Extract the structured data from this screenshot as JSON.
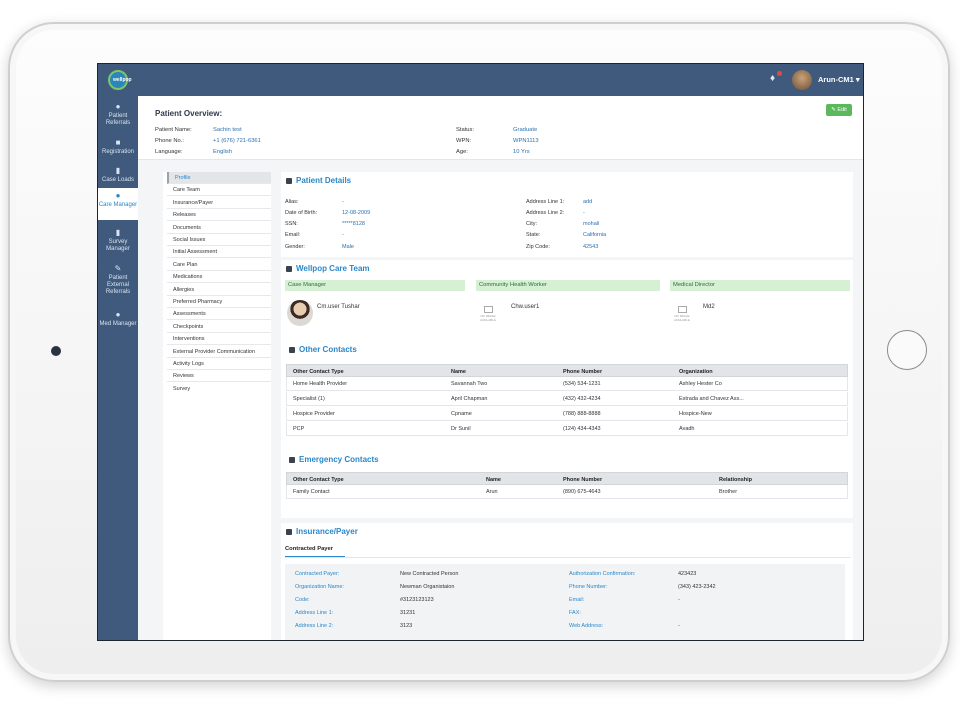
{
  "header": {
    "user_name": "Arun-CM1 ▾",
    "logo_text": "wellpop"
  },
  "sidebar": {
    "items": [
      {
        "label": "Patient Referrals",
        "icon": "users-icon"
      },
      {
        "label": "Registration",
        "icon": "clipboard-icon"
      },
      {
        "label": "Case Loads",
        "icon": "file-icon"
      },
      {
        "label": "Care Manager",
        "icon": "user-icon",
        "active": true
      },
      {
        "label": "Survey Manager",
        "icon": "survey-icon"
      },
      {
        "label": "Patient External Referrals",
        "icon": "edit-icon"
      },
      {
        "label": "Med Manager",
        "icon": "med-user-icon"
      }
    ]
  },
  "overview": {
    "title": "Patient Overview:",
    "edit_label": "✎ Edit",
    "patient_name_label": "Patient Name:",
    "patient_name": "Sachin test",
    "phone_label": "Phone No.:",
    "phone": "+1 (676) 721-6361",
    "language_label": "Language:",
    "language": "English",
    "status_label": "Status:",
    "status": "Graduate",
    "wpn_label": "WPN:",
    "wpn": "WPN1113",
    "age_label": "Age:",
    "age": "10 Yrs"
  },
  "tabs": [
    "Profile",
    "Care Team",
    "Insurance/Payer",
    "Releases",
    "Documents",
    "Social Issues",
    "Initial Assessment",
    "Care Plan",
    "Medications",
    "Allergies",
    "Preferred Pharmacy",
    "Assessments",
    "Checkpoints",
    "Interventions",
    "External Provider Communication",
    "Activity Logs",
    "Reviews",
    "Survey"
  ],
  "patient_details": {
    "title": "Patient Details",
    "alias_label": "Alias:",
    "alias": "-",
    "dob_label": "Date of Birth:",
    "dob": "12-08-2009",
    "ssn_label": "SSN:",
    "ssn": "*****8128",
    "email_label": "Email:",
    "email": "-",
    "gender_label": "Gender:",
    "gender": "Male",
    "addr1_label": "Address Line 1:",
    "addr1": "add",
    "addr2_label": "Address Line 2:",
    "addr2": "-",
    "city_label": "City:",
    "city": "mohali",
    "state_label": "State:",
    "state": "California",
    "zip_label": "Zip Code:",
    "zip": "42543"
  },
  "care_team": {
    "title": "Wellpop Care Team",
    "case_manager_label": "Case Manager",
    "case_manager": "Cm.user Tushar",
    "chw_label": "Community Health Worker",
    "chw": "Chw.user1",
    "md_label": "Medical Director",
    "md": "Md2",
    "no_image": "NO IMAGE AVAILABLE"
  },
  "other_contacts": {
    "title": "Other Contacts",
    "headers": [
      "Other Contact Type",
      "Name",
      "Phone Number",
      "Organization"
    ],
    "rows": [
      [
        "Home Health Provider",
        "Savannah Two",
        "(534) 534-1231",
        "Ashley Hester Co"
      ],
      [
        "Specialist (1)",
        "April Chapman",
        "(432) 432-4234",
        "Estrada and Chavez Ass..."
      ],
      [
        "Hospice Provider",
        "Cpname",
        "(788) 888-8888",
        "Hospice-New"
      ],
      [
        "PCP",
        "Dr Sunil",
        "(124) 434-4343",
        "Avadh"
      ]
    ]
  },
  "emergency_contacts": {
    "title": "Emergency Contacts",
    "headers": [
      "Other Contact Type",
      "Name",
      "Phone Number",
      "Relationship"
    ],
    "rows": [
      [
        "Family Contact",
        "Arun",
        "(890) 675-4643",
        "Brother"
      ]
    ]
  },
  "insurance": {
    "title": "Insurance/Payer",
    "subtab": "Contracted Payer",
    "contracted_payer_label": "Contracted Payer:",
    "contracted_payer": "New Contracted Person",
    "org_label": "Organization Name:",
    "org": "Newman Organistaion",
    "code_label": "Code:",
    "code": "#3123123123",
    "a1_label": "Address Line 1:",
    "a1": "31231",
    "a2_label": "Address Line 2:",
    "a2": "3123",
    "auth_label": "Authorization Confirmation:",
    "auth": "423423",
    "phone_label": "Phone Number:",
    "phone": "(343) 423-2342",
    "email_label": "Email:",
    "email": "-",
    "fax_label": "FAX:",
    "fax": "",
    "web_label": "Web Address:",
    "web": "-"
  }
}
